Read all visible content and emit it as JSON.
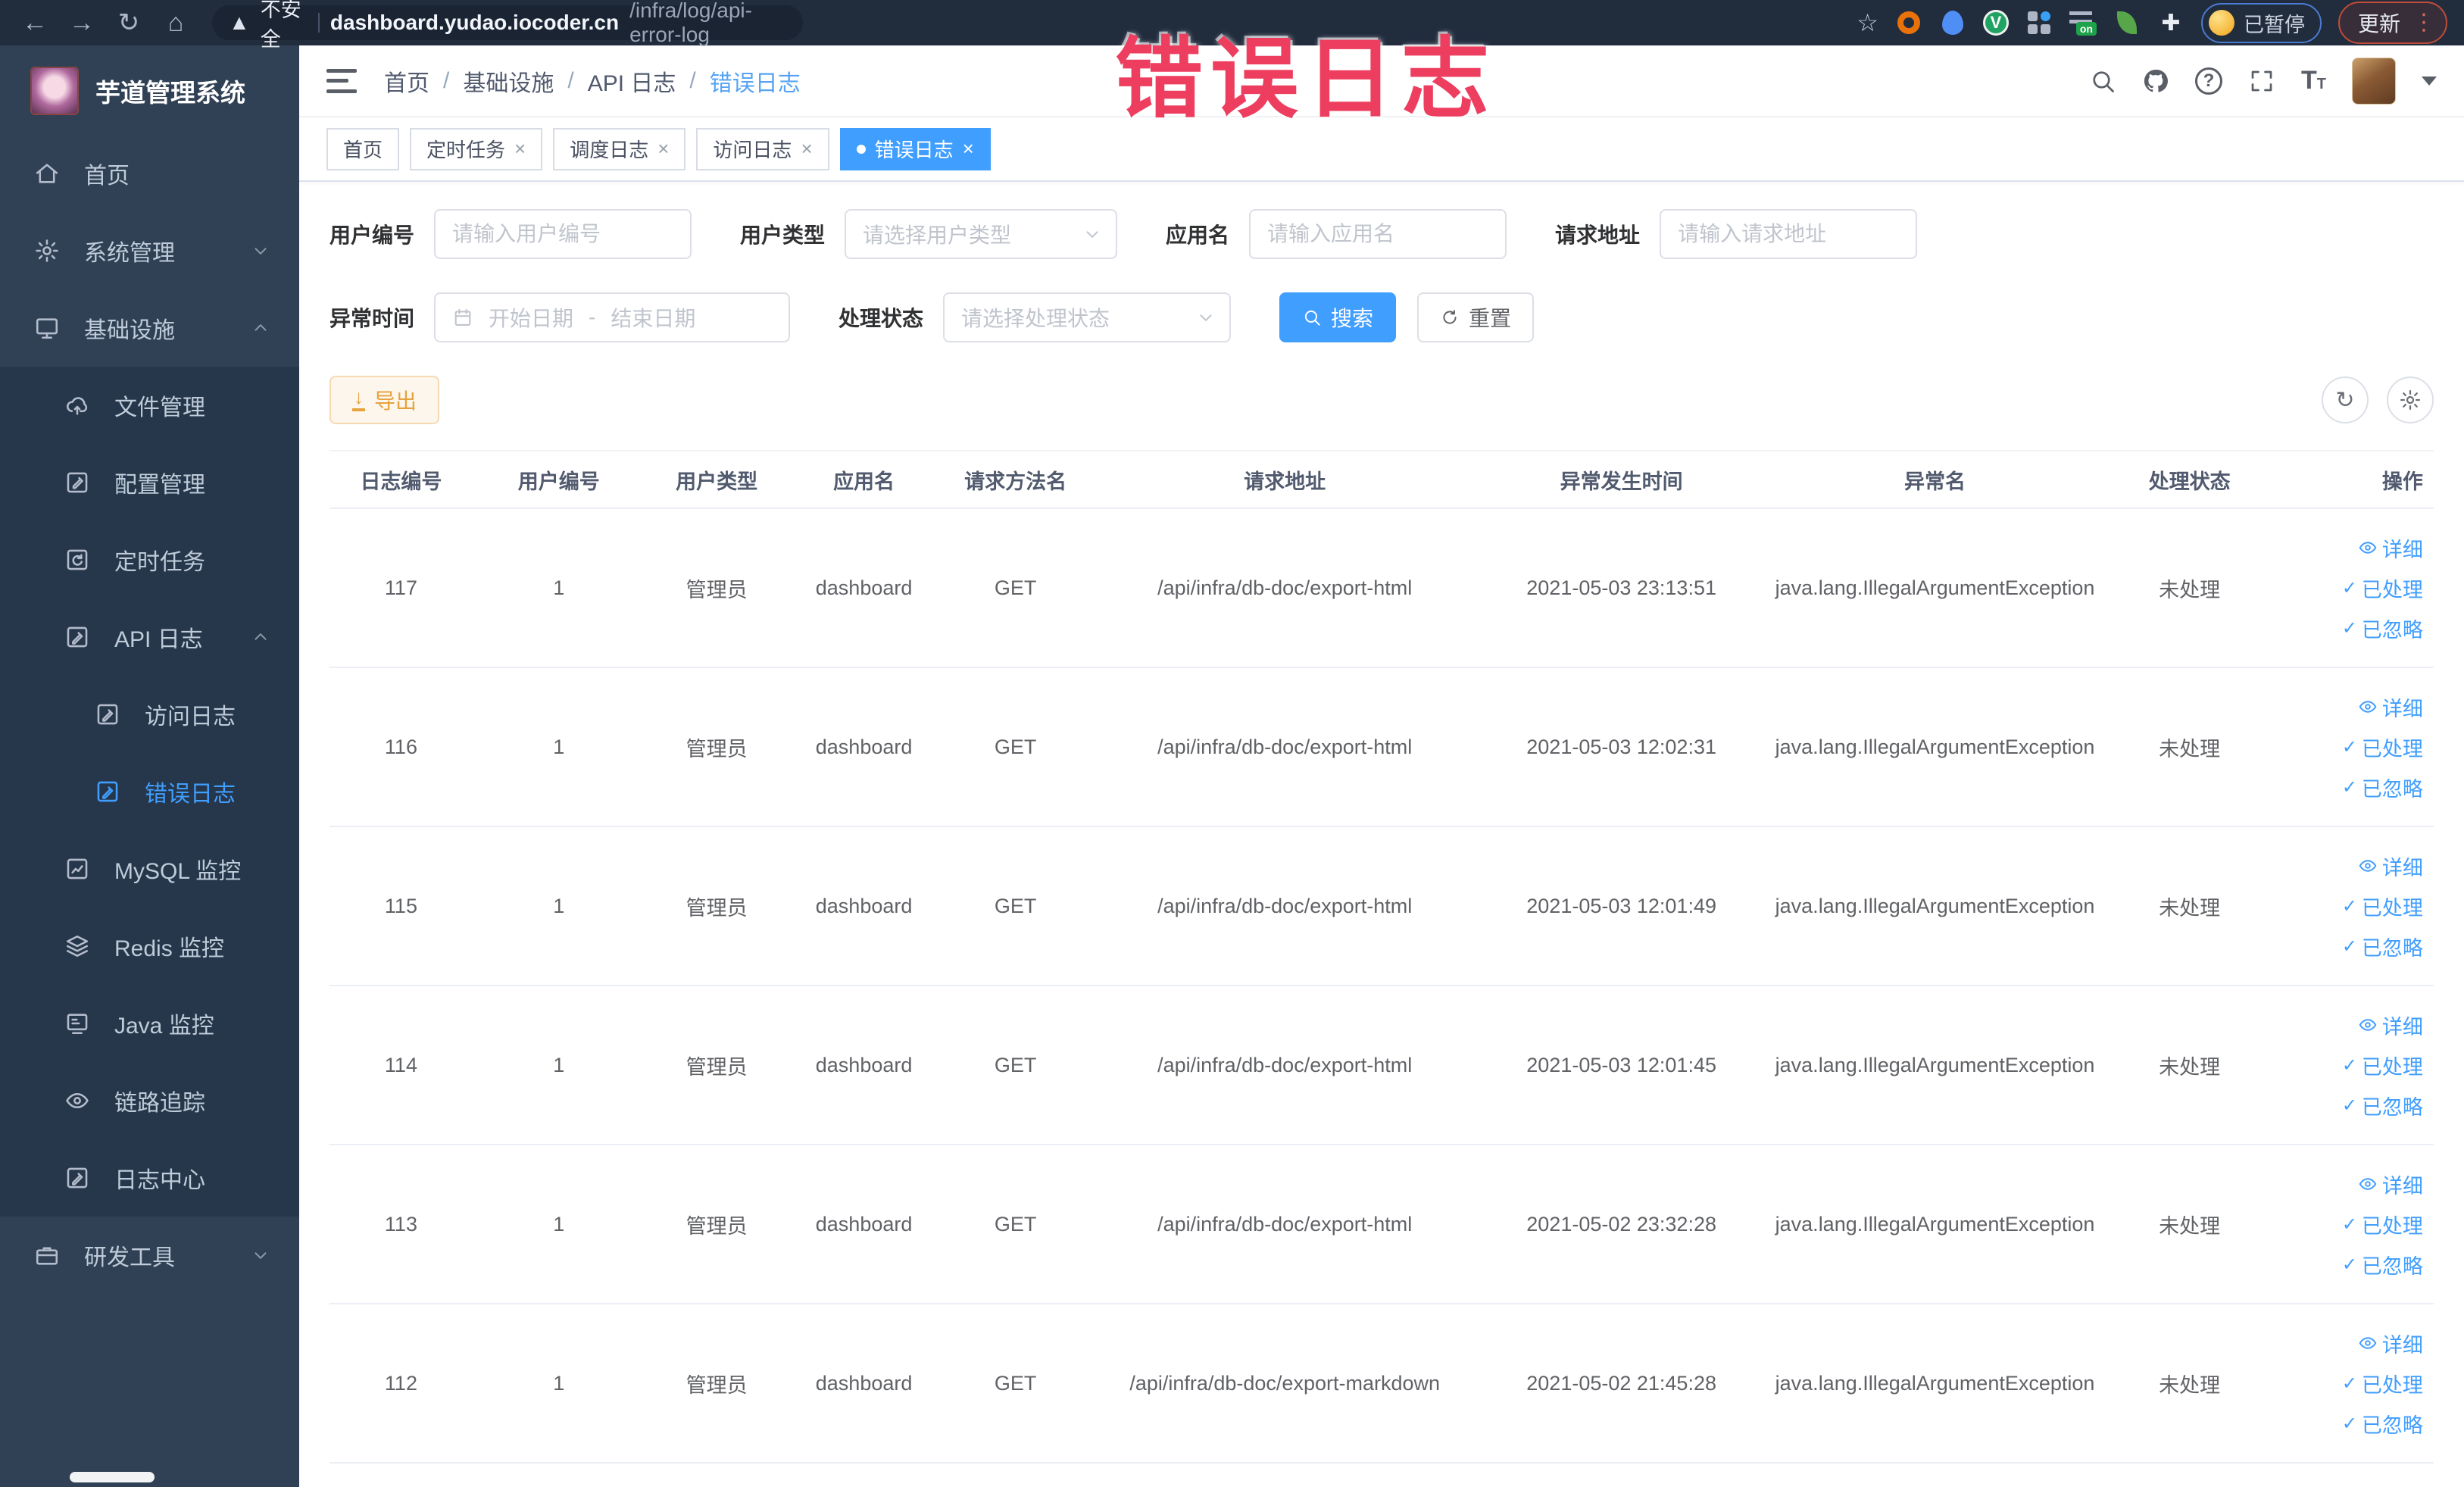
{
  "browser": {
    "security_label": "不安全",
    "url_domain": "dashboard.yudao.iocoder.cn",
    "url_path": "/infra/log/api-error-log",
    "paused_badge": "已暂停",
    "update_label": "更新"
  },
  "annotation": {
    "text": "错误日志"
  },
  "sidebar": {
    "logo_title": "芋道管理系统",
    "items": [
      {
        "label": "首页"
      },
      {
        "label": "系统管理"
      },
      {
        "label": "基础设施"
      },
      {
        "label": "文件管理"
      },
      {
        "label": "配置管理"
      },
      {
        "label": "定时任务"
      },
      {
        "label": "API 日志"
      },
      {
        "label": "访问日志"
      },
      {
        "label": "错误日志"
      },
      {
        "label": "MySQL 监控"
      },
      {
        "label": "Redis 监控"
      },
      {
        "label": "Java 监控"
      },
      {
        "label": "链路追踪"
      },
      {
        "label": "日志中心"
      },
      {
        "label": "研发工具"
      }
    ]
  },
  "header": {
    "breadcrumb": [
      "首页",
      "基础设施",
      "API 日志",
      "错误日志"
    ],
    "separator": "/"
  },
  "tabs": [
    {
      "label": "首页",
      "closable": false,
      "active": false
    },
    {
      "label": "定时任务",
      "closable": true,
      "active": false
    },
    {
      "label": "调度日志",
      "closable": true,
      "active": false
    },
    {
      "label": "访问日志",
      "closable": true,
      "active": false
    },
    {
      "label": "错误日志",
      "closable": true,
      "active": true
    }
  ],
  "filters": {
    "user_id": {
      "label": "用户编号",
      "placeholder": "请输入用户编号"
    },
    "user_type": {
      "label": "用户类型",
      "placeholder": "请选择用户类型"
    },
    "app_name": {
      "label": "应用名",
      "placeholder": "请输入应用名"
    },
    "request_url": {
      "label": "请求地址",
      "placeholder": "请输入请求地址"
    },
    "exception_time": {
      "label": "异常时间",
      "start_placeholder": "开始日期",
      "separator": "-",
      "end_placeholder": "结束日期"
    },
    "process_status": {
      "label": "处理状态",
      "placeholder": "请选择处理状态"
    },
    "search_label": "搜索",
    "reset_label": "重置"
  },
  "toolbar": {
    "export_label": "导出"
  },
  "table": {
    "columns": [
      "日志编号",
      "用户编号",
      "用户类型",
      "应用名",
      "请求方法名",
      "请求地址",
      "异常发生时间",
      "异常名",
      "处理状态",
      "操作"
    ],
    "action_labels": [
      "详细",
      "已处理",
      "已忽略"
    ],
    "rows": [
      {
        "id": "117",
        "user_id": "1",
        "user_type": "管理员",
        "app": "dashboard",
        "method": "GET",
        "url": "/api/infra/db-doc/export-html",
        "time": "2021-05-03 23:13:51",
        "exception": "java.lang.IllegalArgumentException",
        "status": "未处理"
      },
      {
        "id": "116",
        "user_id": "1",
        "user_type": "管理员",
        "app": "dashboard",
        "method": "GET",
        "url": "/api/infra/db-doc/export-html",
        "time": "2021-05-03 12:02:31",
        "exception": "java.lang.IllegalArgumentException",
        "status": "未处理"
      },
      {
        "id": "115",
        "user_id": "1",
        "user_type": "管理员",
        "app": "dashboard",
        "method": "GET",
        "url": "/api/infra/db-doc/export-html",
        "time": "2021-05-03 12:01:49",
        "exception": "java.lang.IllegalArgumentException",
        "status": "未处理"
      },
      {
        "id": "114",
        "user_id": "1",
        "user_type": "管理员",
        "app": "dashboard",
        "method": "GET",
        "url": "/api/infra/db-doc/export-html",
        "time": "2021-05-03 12:01:45",
        "exception": "java.lang.IllegalArgumentException",
        "status": "未处理"
      },
      {
        "id": "113",
        "user_id": "1",
        "user_type": "管理员",
        "app": "dashboard",
        "method": "GET",
        "url": "/api/infra/db-doc/export-html",
        "time": "2021-05-02 23:32:28",
        "exception": "java.lang.IllegalArgumentException",
        "status": "未处理"
      },
      {
        "id": "112",
        "user_id": "1",
        "user_type": "管理员",
        "app": "dashboard",
        "method": "GET",
        "url": "/api/infra/db-doc/export-markdown",
        "time": "2021-05-02 21:45:28",
        "exception": "java.lang.IllegalArgumentException",
        "status": "未处理"
      }
    ]
  },
  "colors": {
    "accent": "#409eff",
    "annotation_red": "#ee3e5f",
    "warning_orange": "#e6a23c",
    "sidebar_bg": "#304156"
  }
}
